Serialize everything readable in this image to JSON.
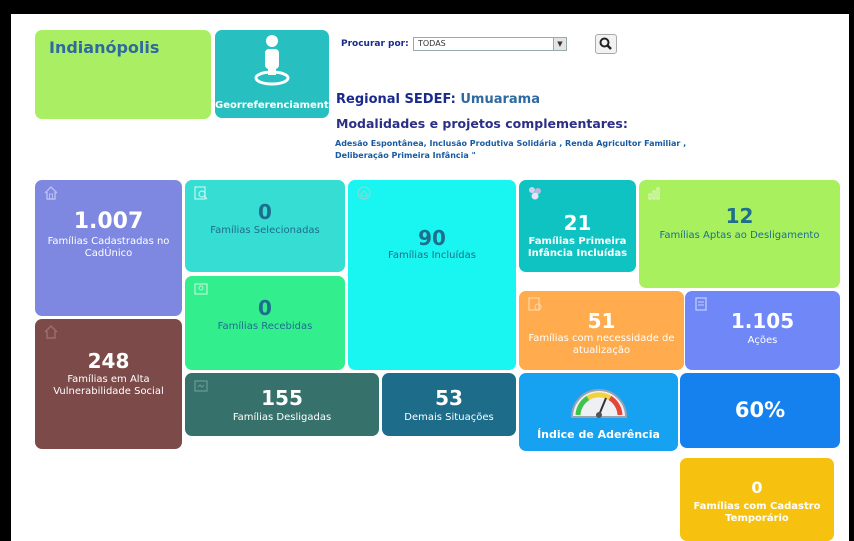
{
  "city": "Indianópolis",
  "geo_label": "Georreferenciamento",
  "search": {
    "label": "Procurar por:",
    "value": "TODAS"
  },
  "regional": {
    "prefix": "Regional SEDEF:",
    "value": "Umuarama"
  },
  "modalidades": {
    "title": "Modalidades e projetos complementares:",
    "line1": "Adesão Espontânea, Inclusão Produtiva Solidária , Renda Agricultor Familiar ,",
    "line2": "Deliberação Primeira Infância \""
  },
  "cards": {
    "cadastradas": {
      "value": "1.007",
      "label": "Famílias Cadastradas no CadÚnico",
      "color": "#7e88e0"
    },
    "selecionadas": {
      "value": "0",
      "label": "Famílias Selecionadas",
      "color": "#36ddd2"
    },
    "incluidas": {
      "value": "90",
      "label": "Famílias Incluídas",
      "color": "#19f5f0"
    },
    "primeira_infancia": {
      "value": "21",
      "label": "Famílias Primeira Infância Incluídas",
      "color": "#0fc3c3"
    },
    "aptas": {
      "value": "12",
      "label": "Famílias Aptas ao Desligamento",
      "color": "#a9f05e"
    },
    "recebidas": {
      "value": "0",
      "label": "Famílias Recebidas",
      "color": "#33ee8d"
    },
    "atualizacao": {
      "value": "51",
      "label": "Famílias com necessidade de atualização",
      "color": "#ffab4e"
    },
    "acoes": {
      "value": "1.105",
      "label": "Ações",
      "color": "#6f87f7"
    },
    "vulnerabilidade": {
      "value": "248",
      "label": "Famílias em Alta Vulnerabilidade Social",
      "color": "#7d4a4a"
    },
    "desligadas": {
      "value": "155",
      "label": "Famílias Desligadas",
      "color": "#37716b"
    },
    "demais": {
      "value": "53",
      "label": "Demais Situações",
      "color": "#1d6c8a"
    },
    "aderencia": {
      "label": "Índice de Aderência",
      "color": "#17a1f1"
    },
    "percent": {
      "value": "60%",
      "color": "#1481ee"
    },
    "temporario": {
      "value": "0",
      "label": "Famílias com Cadastro Temporário",
      "color": "#f7c20f"
    }
  }
}
